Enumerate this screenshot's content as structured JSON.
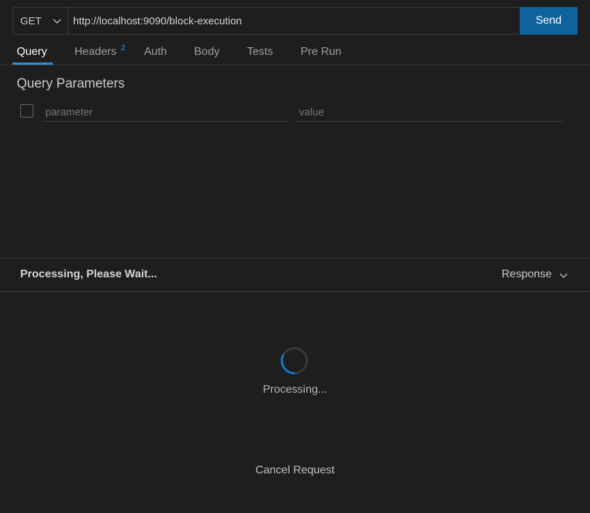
{
  "request": {
    "method": "GET",
    "url": "http://localhost:9090/block-execution",
    "send_label": "Send"
  },
  "tabs": [
    {
      "label": "Query",
      "active": true
    },
    {
      "label": "Headers",
      "badge": "2"
    },
    {
      "label": "Auth"
    },
    {
      "label": "Body"
    },
    {
      "label": "Tests"
    },
    {
      "label": "Pre Run"
    }
  ],
  "query": {
    "title": "Query Parameters",
    "param_placeholder": "parameter",
    "value_placeholder": "value"
  },
  "response": {
    "status_text": "Processing, Please Wait...",
    "view_select": "Response",
    "loading_text": "Processing...",
    "cancel_label": "Cancel Request"
  },
  "colors": {
    "background": "#1e1e1e",
    "accent": "#0e639c",
    "tab_underline": "#2f8fd7",
    "badge": "#3794ff"
  },
  "icons": {
    "method_dropdown": "chevron-down-icon",
    "response_dropdown": "chevron-down-icon",
    "loading": "spinner-icon"
  }
}
